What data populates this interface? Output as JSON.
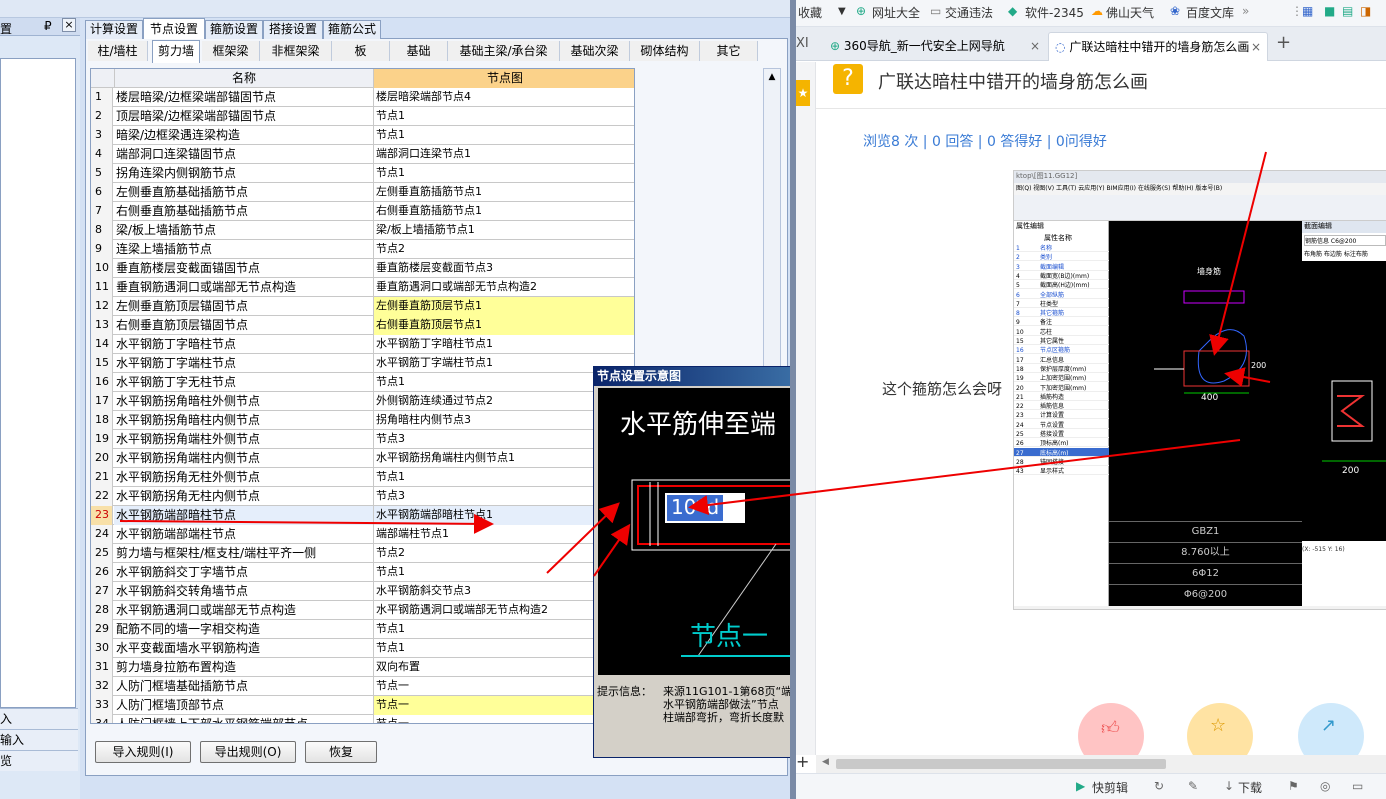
{
  "left_app": {
    "left_panel": {
      "header": "置",
      "pin": "₽",
      "close": "×",
      "bottom_items": [
        "入",
        "输入",
        "览"
      ]
    },
    "main_tabs": [
      "计算设置",
      "节点设置",
      "箍筋设置",
      "搭接设置",
      "箍筋公式"
    ],
    "active_main_tab": "节点设置",
    "sub_tabs": [
      "柱/墙柱",
      "剪力墙",
      "框架梁",
      "非框架梁",
      "板",
      "基础",
      "基础主梁/承台梁",
      "基础次梁",
      "砌体结构",
      "其它"
    ],
    "active_sub_tab": "剪力墙",
    "grid": {
      "col_name": "名称",
      "col_node": "节点图",
      "rows": [
        {
          "n": "1",
          "name": "楼层暗梁/边框梁端部锚固节点",
          "node": "楼层暗梁端部节点4",
          "hl": false
        },
        {
          "n": "2",
          "name": "顶层暗梁/边框梁端部锚固节点",
          "node": "节点1",
          "hl": false
        },
        {
          "n": "3",
          "name": "暗梁/边框梁遇连梁构造",
          "node": "节点1",
          "hl": false
        },
        {
          "n": "4",
          "name": "端部洞口连梁锚固节点",
          "node": "端部洞口连梁节点1",
          "hl": false
        },
        {
          "n": "5",
          "name": "拐角连梁内侧钢筋节点",
          "node": "节点1",
          "hl": false
        },
        {
          "n": "6",
          "name": "左侧垂直筋基础插筋节点",
          "node": "左侧垂直筋插筋节点1",
          "hl": false
        },
        {
          "n": "7",
          "name": "右侧垂直筋基础插筋节点",
          "node": "右侧垂直筋插筋节点1",
          "hl": false
        },
        {
          "n": "8",
          "name": "梁/板上墙插筋节点",
          "node": "梁/板上墙插筋节点1",
          "hl": false
        },
        {
          "n": "9",
          "name": "连梁上墙插筋节点",
          "node": "节点2",
          "hl": false
        },
        {
          "n": "10",
          "name": "垂直筋楼层变截面锚固节点",
          "node": "垂直筋楼层变截面节点3",
          "hl": false
        },
        {
          "n": "11",
          "name": "垂直钢筋遇洞口或端部无节点构造",
          "node": "垂直筋遇洞口或端部无节点构造2",
          "hl": false
        },
        {
          "n": "12",
          "name": "左侧垂直筋顶层锚固节点",
          "node": "左侧垂直筋顶层节点1",
          "hl": true
        },
        {
          "n": "13",
          "name": "右侧垂直筋顶层锚固节点",
          "node": "右侧垂直筋顶层节点1",
          "hl": true
        },
        {
          "n": "14",
          "name": "水平钢筋丁字暗柱节点",
          "node": "水平钢筋丁字暗柱节点1",
          "hl": false
        },
        {
          "n": "15",
          "name": "水平钢筋丁字端柱节点",
          "node": "水平钢筋丁字端柱节点1",
          "hl": false
        },
        {
          "n": "16",
          "name": "水平钢筋丁字无柱节点",
          "node": "节点1",
          "hl": false
        },
        {
          "n": "17",
          "name": "水平钢筋拐角暗柱外侧节点",
          "node": "外侧钢筋连续通过节点2",
          "hl": false
        },
        {
          "n": "18",
          "name": "水平钢筋拐角暗柱内侧节点",
          "node": "拐角暗柱内侧节点3",
          "hl": false
        },
        {
          "n": "19",
          "name": "水平钢筋拐角端柱外侧节点",
          "node": "节点3",
          "hl": false
        },
        {
          "n": "20",
          "name": "水平钢筋拐角端柱内侧节点",
          "node": "水平钢筋拐角端柱内侧节点1",
          "hl": false
        },
        {
          "n": "21",
          "name": "水平钢筋拐角无柱外侧节点",
          "node": "节点1",
          "hl": false
        },
        {
          "n": "22",
          "name": "水平钢筋拐角无柱内侧节点",
          "node": "节点3",
          "hl": false
        },
        {
          "n": "23",
          "name": "水平钢筋端部暗柱节点",
          "node": "水平钢筋端部暗柱节点1",
          "hl": false,
          "sel": true
        },
        {
          "n": "24",
          "name": "水平钢筋端部端柱节点",
          "node": "端部端柱节点1",
          "hl": false
        },
        {
          "n": "25",
          "name": "剪力墙与框架柱/框支柱/端柱平齐一侧",
          "node": "节点2",
          "hl": false
        },
        {
          "n": "26",
          "name": "水平钢筋斜交丁字墙节点",
          "node": "节点1",
          "hl": false
        },
        {
          "n": "27",
          "name": "水平钢筋斜交转角墙节点",
          "node": "水平钢筋斜交节点3",
          "hl": false
        },
        {
          "n": "28",
          "name": "水平钢筋遇洞口或端部无节点构造",
          "node": "水平钢筋遇洞口或端部无节点构造2",
          "hl": false
        },
        {
          "n": "29",
          "name": "配筋不同的墙一字相交构造",
          "node": "节点1",
          "hl": false
        },
        {
          "n": "30",
          "name": "水平变截面墙水平钢筋构造",
          "node": "节点1",
          "hl": false
        },
        {
          "n": "31",
          "name": "剪力墙身拉筋布置构造",
          "node": "双向布置",
          "hl": false
        },
        {
          "n": "32",
          "name": "人防门框墙基础插筋节点",
          "node": "节点一",
          "hl": false
        },
        {
          "n": "33",
          "name": "人防门框墙顶部节点",
          "node": "节点一",
          "hl": true
        },
        {
          "n": "34",
          "name": "人防门框墙上下部水平钢筋端部节点",
          "node": "节点一",
          "hl": false
        }
      ]
    },
    "buttons": {
      "import": "导入规则(I)",
      "export": "导出规则(O)",
      "restore": "恢复"
    },
    "popup": {
      "title": "节点设置示意图",
      "diagram_text": "水平筋伸至端",
      "dim_label": "10*d",
      "node_label": "节点一",
      "tip_label": "提示信息：",
      "tip_lines": [
        "来源11G101-1第68页“端",
        "水平钢筋端部做法”节点",
        "柱端部弯折，弯折长度默"
      ]
    }
  },
  "browser": {
    "bookmarks": [
      "收藏",
      "网址大全",
      "交通违法",
      "软件-2345",
      "佛山天气",
      "百度文库"
    ],
    "tabs": [
      {
        "label": "360导航_新一代安全上网导航",
        "active": false
      },
      {
        "label": "广联达暗柱中错开的墙身筋怎么画",
        "active": true
      }
    ],
    "tab_left_fragment": "XI",
    "question": {
      "title": "广联达暗柱中错开的墙身筋怎么画",
      "stats": "浏览8 次 | 0 回答 | 0 答得好 | 0问得好",
      "body_text": "这个箍筋怎么会呀"
    },
    "screenshot": {
      "window_title": "ktop\\[图11.GG12]",
      "menu": "图(Q) 视图(V) 工具(T) 云应用(Y) BIM应用(I) 在线服务(S) 帮助(H) 版本号(B)",
      "panel_title": "属性编辑",
      "col_header": "属性名称",
      "props": [
        {
          "n": "1",
          "t": "名称",
          "blue": true
        },
        {
          "n": "2",
          "t": "类别",
          "blue": true
        },
        {
          "n": "3",
          "t": "截面编辑",
          "blue": true
        },
        {
          "n": "4",
          "t": "截面宽(B边)(mm)",
          "blue": false
        },
        {
          "n": "5",
          "t": "截面高(H边)(mm)",
          "blue": false
        },
        {
          "n": "6",
          "t": "全部纵筋",
          "blue": true
        },
        {
          "n": "7",
          "t": "柱类型",
          "blue": false
        },
        {
          "n": "8",
          "t": "其它箍筋",
          "blue": true
        },
        {
          "n": "9",
          "t": "备注",
          "blue": false
        },
        {
          "n": "10",
          "t": "芯柱",
          "blue": false
        },
        {
          "n": "15",
          "t": "其它属性",
          "blue": false
        },
        {
          "n": "16",
          "t": "节点区箍筋",
          "blue": true
        },
        {
          "n": "17",
          "t": "汇总信息",
          "blue": false
        },
        {
          "n": "18",
          "t": "保护层厚度(mm)",
          "blue": false
        },
        {
          "n": "19",
          "t": "上加密范围(mm)",
          "blue": false
        },
        {
          "n": "20",
          "t": "下加密范围(mm)",
          "blue": false
        },
        {
          "n": "21",
          "t": "插筋构造",
          "blue": false
        },
        {
          "n": "22",
          "t": "插筋信息",
          "blue": false
        },
        {
          "n": "23",
          "t": "计算设置",
          "blue": false
        },
        {
          "n": "24",
          "t": "节点设置",
          "blue": false
        },
        {
          "n": "25",
          "t": "搭接设置",
          "blue": false
        },
        {
          "n": "26",
          "t": "顶标高(m)",
          "blue": false
        },
        {
          "n": "27",
          "t": "底标高(m)",
          "blue": false
        },
        {
          "n": "28",
          "t": "锚固搭接",
          "blue": false
        },
        {
          "n": "43",
          "t": "显示样式",
          "blue": false
        }
      ],
      "cad_labels": {
        "wall": "墙身筋",
        "dim_w": "400",
        "dim_h": "200",
        "right_dim": "200"
      },
      "table_rows": [
        "GBZ1",
        "8.760以上",
        "6Φ12",
        "Φ6@200"
      ],
      "right_panel_title": "截面编辑",
      "right_field": "钢筋信息 C6@200",
      "right_tabs": "布角筋 布边筋 标注布筋",
      "coord": "(X: -515 Y: 16)"
    },
    "status": [
      "快剪辑",
      "下载"
    ]
  }
}
